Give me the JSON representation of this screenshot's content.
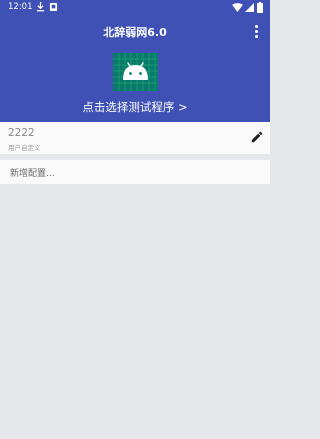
{
  "statusbar": {
    "time": "12:01"
  },
  "toolbar": {
    "title": "北辞弱网6.0",
    "more_icon": "more-vert-icon"
  },
  "hero": {
    "app_icon": "android-icon",
    "select_label": "点击选择测试程序 >"
  },
  "config": {
    "name": "2222",
    "type": "用户自定义",
    "edit_icon": "pencil-icon"
  },
  "add": {
    "label": "新增配置..."
  },
  "colors": {
    "primary": "#3f51b5",
    "android_green": "#3ddc84",
    "background": "#e6e7ea",
    "card": "#fafafa"
  }
}
